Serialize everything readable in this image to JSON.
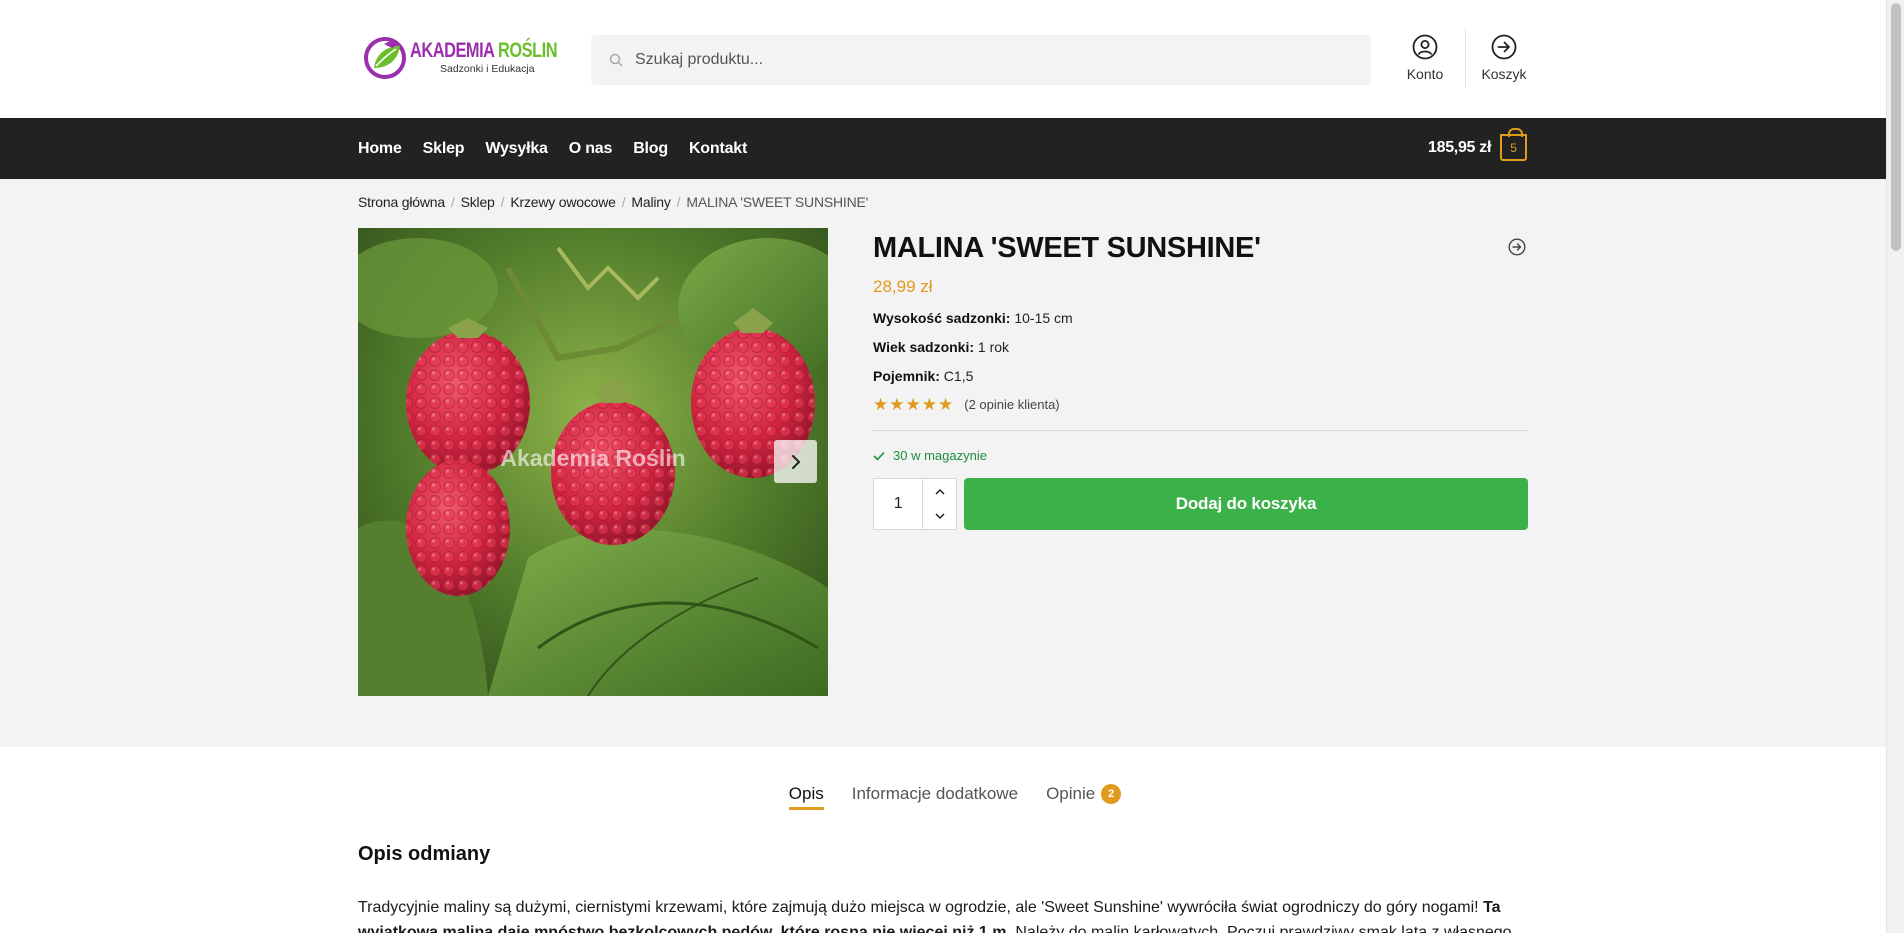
{
  "header": {
    "logo_title_1": "AKADEMIA",
    "logo_title_2": "ROŚLIN",
    "logo_subtitle": "Sadzonki i Edukacja",
    "search_placeholder": "Szukaj produktu...",
    "account_label": "Konto",
    "cart_label": "Koszyk"
  },
  "nav": {
    "items": [
      "Home",
      "Sklep",
      "Wysyłka",
      "O nas",
      "Blog",
      "Kontakt"
    ],
    "cart_total": "185,95 zł",
    "cart_count": "5"
  },
  "breadcrumb": [
    "Strona główna",
    "Sklep",
    "Krzewy owocowe",
    "Maliny",
    "MALINA 'SWEET SUNSHINE'"
  ],
  "gallery": {
    "watermark": "Akademia Roślin"
  },
  "product": {
    "title": "MALINA 'SWEET SUNSHINE'",
    "price": "28,99 zł",
    "attributes": [
      {
        "label": "Wysokość sadzonki:",
        "value": "10-15 cm"
      },
      {
        "label": "Wiek sadzonki:",
        "value": "1 rok"
      },
      {
        "label": "Pojemnik:",
        "value": "C1,5"
      }
    ],
    "rating": 5,
    "reviews_text": "(2 opinie klienta)",
    "stock_text": "30 w magazynie",
    "quantity": "1",
    "add_to_cart": "Dodaj do koszyka"
  },
  "tabs": {
    "items": [
      {
        "label": "Opis"
      },
      {
        "label": "Informacje dodatkowe"
      },
      {
        "label": "Opinie",
        "badge": "2"
      }
    ],
    "active": 0
  },
  "description": {
    "heading": "Opis odmiany",
    "text_plain": "Tradycyjnie maliny są dużymi, ciernistymi krzewami, które zajmują dużo miejsca w ogrodzie, ale 'Sweet Sunshine' wywróciła świat ogrodniczy do góry nogami! ",
    "text_bold": "Ta wyjątkowa malina daje mnóstwo bezkolcowych pędów, które rosną nie więcej niż 1 m",
    "text_tail": ". Należy do malin karłowatych. Poczuj prawdziwy smak lata z własnego"
  },
  "colors": {
    "accent": "#e09a1e",
    "button_green": "#3cb14a",
    "nav_bg": "#222222",
    "stock_green": "#1e8e3e",
    "logo_purple": "#9b2fae",
    "logo_green": "#6cbf2c"
  }
}
